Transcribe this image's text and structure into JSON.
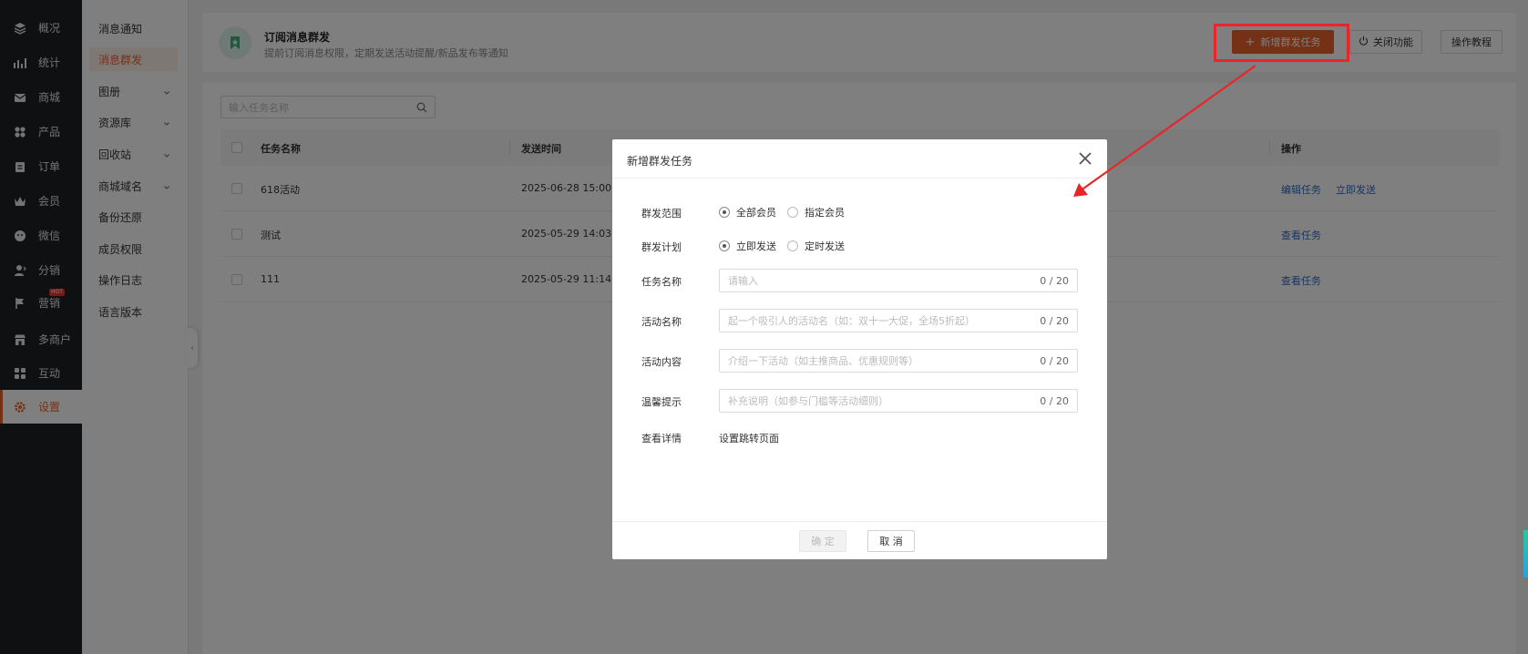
{
  "nav": {
    "items": [
      {
        "label": "概况"
      },
      {
        "label": "统计"
      },
      {
        "label": "商城"
      },
      {
        "label": "产品"
      },
      {
        "label": "订单"
      },
      {
        "label": "会员"
      },
      {
        "label": "微信"
      },
      {
        "label": "分销"
      },
      {
        "label": "营销",
        "badge": "HOT"
      },
      {
        "label": "多商户"
      },
      {
        "label": "互动"
      },
      {
        "label": "设置"
      }
    ]
  },
  "submenu": {
    "items": [
      {
        "label": "消息通知"
      },
      {
        "label": "消息群发"
      },
      {
        "label": "图册"
      },
      {
        "label": "资源库"
      },
      {
        "label": "回收站"
      },
      {
        "label": "商城域名"
      },
      {
        "label": "备份还原"
      },
      {
        "label": "成员权限"
      },
      {
        "label": "操作日志"
      },
      {
        "label": "语言版本"
      }
    ]
  },
  "header": {
    "title": "订阅消息群发",
    "description": "提前订阅消息权限，定期发送活动提醒/新品发布等通知",
    "add_button": "新增群发任务",
    "close_button": "关闭功能",
    "tutorial_button": "操作教程"
  },
  "search": {
    "placeholder": "输入任务名称"
  },
  "table": {
    "columns": [
      "任务名称",
      "发送时间",
      "操作"
    ],
    "rows": [
      {
        "name": "618活动",
        "time": "2025-06-28 15:00",
        "actions": [
          "编辑任务",
          "立即发送"
        ]
      },
      {
        "name": "测试",
        "time": "2025-05-29 14:03",
        "actions": [
          "查看任务"
        ]
      },
      {
        "name": "111",
        "time": "2025-05-29 11:14",
        "actions": [
          "查看任务"
        ]
      }
    ]
  },
  "modal": {
    "title": "新增群发任务",
    "scope_label": "群发范围",
    "scope_options": [
      "全部会员",
      "指定会员"
    ],
    "plan_label": "群发计划",
    "plan_options": [
      "立即发送",
      "定时发送"
    ],
    "task_name_label": "任务名称",
    "task_name_placeholder": "请输入",
    "activity_name_label": "活动名称",
    "activity_name_placeholder": "起一个吸引人的活动名（如：双十一大促，全场5折起）",
    "activity_content_label": "活动内容",
    "activity_content_placeholder": "介绍一下活动（如主推商品、优惠规则等）",
    "tip_label": "温馨提示",
    "tip_placeholder": "补充说明（如参与门槛等活动细则）",
    "counter": "0 / 20",
    "detail_label": "查看详情",
    "detail_link": "设置跳转页面",
    "confirm_button": "确 定",
    "cancel_button": "取 消"
  },
  "colors": {
    "accent": "#e8622a",
    "link": "#2d6cc2",
    "highlight": "#e8262a",
    "nav_bg": "#1f2022"
  }
}
